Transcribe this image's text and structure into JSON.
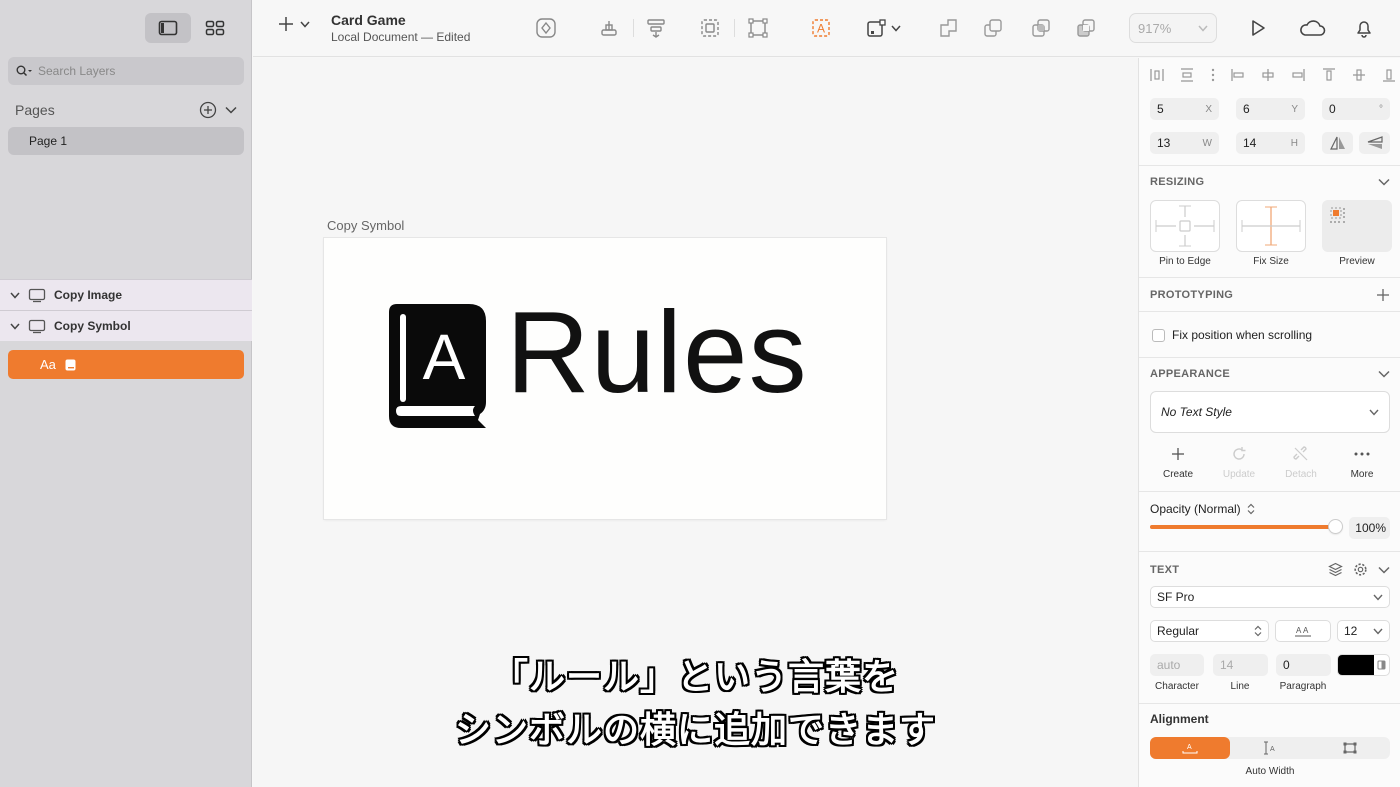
{
  "sidebar": {
    "search_placeholder": "Search Layers",
    "pages_label": "Pages",
    "pages": [
      "Page 1"
    ],
    "layers": [
      {
        "name": "Copy Image"
      },
      {
        "name": "Copy Symbol"
      }
    ],
    "selected_layer_label": "Aa"
  },
  "toolbar": {
    "doc_title": "Card Game",
    "doc_subtitle": "Local Document — Edited",
    "zoom": "917%",
    "accent": "#ef7b2e"
  },
  "canvas": {
    "artboard_label": "Copy Symbol",
    "symbol_glyph": "A",
    "symbol_text": "Rules",
    "caption_line1": "「ルール」という言葉を",
    "caption_line2": "シンボルの横に追加できます"
  },
  "inspector": {
    "x": "5",
    "x_unit": "X",
    "y": "6",
    "y_unit": "Y",
    "rotation": "0",
    "rotation_unit": "°",
    "w": "13",
    "w_unit": "W",
    "h": "14",
    "h_unit": "H",
    "resizing_header": "RESIZING",
    "resizing_options": [
      "Pin to Edge",
      "Fix Size",
      "Preview"
    ],
    "prototyping_header": "PROTOTYPING",
    "fix_position_label": "Fix position when scrolling",
    "appearance_header": "APPEARANCE",
    "text_style": "No Text Style",
    "style_actions": [
      "Create",
      "Update",
      "Detach",
      "More"
    ],
    "opacity_label": "Opacity (Normal)",
    "opacity_value": "100%",
    "opacity": 1.0,
    "text_header": "TEXT",
    "font_family": "SF Pro",
    "font_weight": "Regular",
    "font_size": "12",
    "character_value": "auto",
    "line_value": "14",
    "paragraph_value": "0",
    "character_label": "Character",
    "line_label": "Line",
    "paragraph_label": "Paragraph",
    "text_color": "#000000",
    "alignment_header": "Alignment",
    "alignment_mode": "Auto Width"
  }
}
